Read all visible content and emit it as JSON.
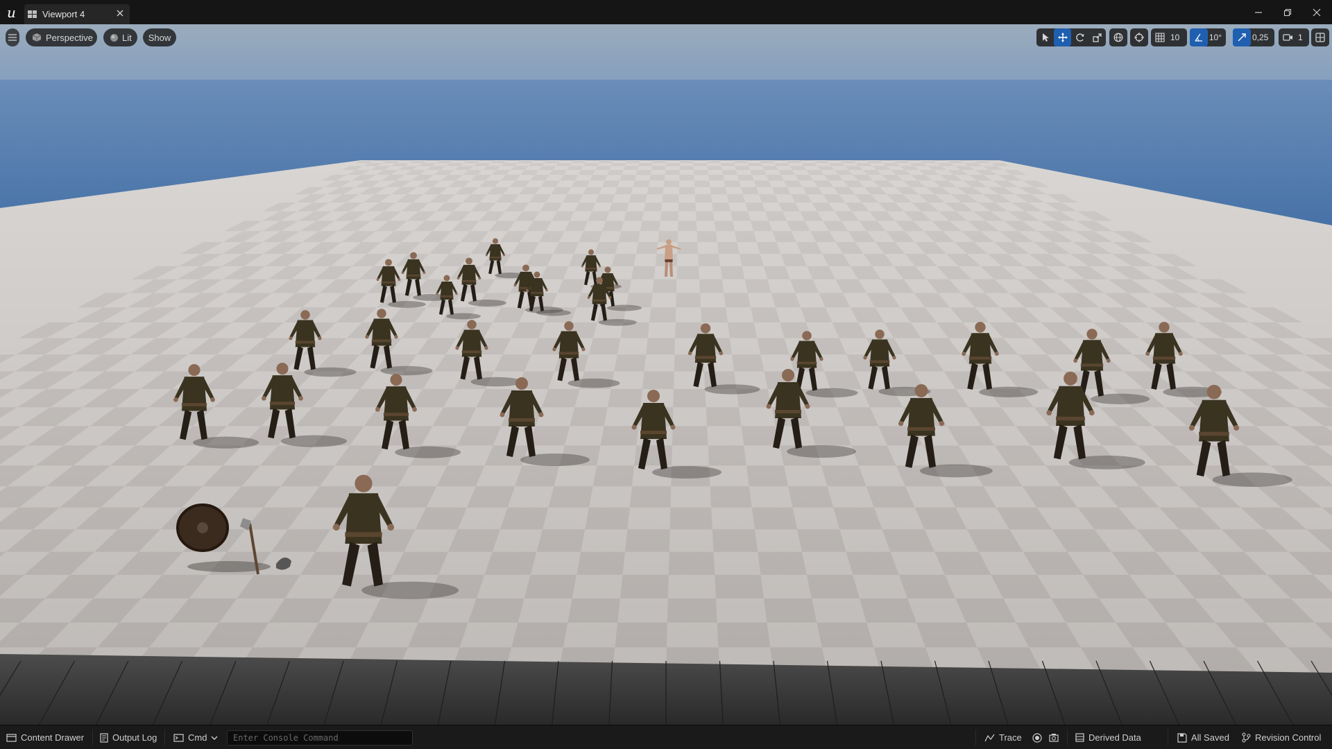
{
  "window": {
    "tab_title": "Viewport 4",
    "controls": [
      "minimize-icon",
      "restore-icon",
      "close-icon"
    ]
  },
  "viewport_toolbar": {
    "left": {
      "menu_icon": "hamburger-menu-icon",
      "view_mode": "Perspective",
      "lighting": "Lit",
      "show": "Show"
    },
    "right": {
      "transform_tools": [
        "select-arrow-icon",
        "translate-icon",
        "rotate-icon",
        "scale-icon"
      ],
      "active_tool": "translate",
      "world_local_icon": "globe-icon",
      "surface_snap_icon": "surface-snap-icon",
      "grid_snap": "10",
      "rotation_snap": "10°",
      "scale_snap": "0,25",
      "camera_speed": "1",
      "layout_icon": "viewport-layout-icon"
    }
  },
  "scene": {
    "sky_top": "#3f6aa0",
    "sky_horizon": "#8fb3d1",
    "floor_light": "#d4d0cd",
    "floor_dark": "#aeaaa8",
    "character_color": "#3a3320"
  },
  "status_bar": {
    "content_drawer": "Content Drawer",
    "output_log": "Output Log",
    "cmd": "Cmd",
    "console_placeholder": "Enter Console Command",
    "trace": "Trace",
    "derived_data": "Derived Data",
    "all_saved": "All Saved",
    "revision_control": "Revision Control"
  }
}
